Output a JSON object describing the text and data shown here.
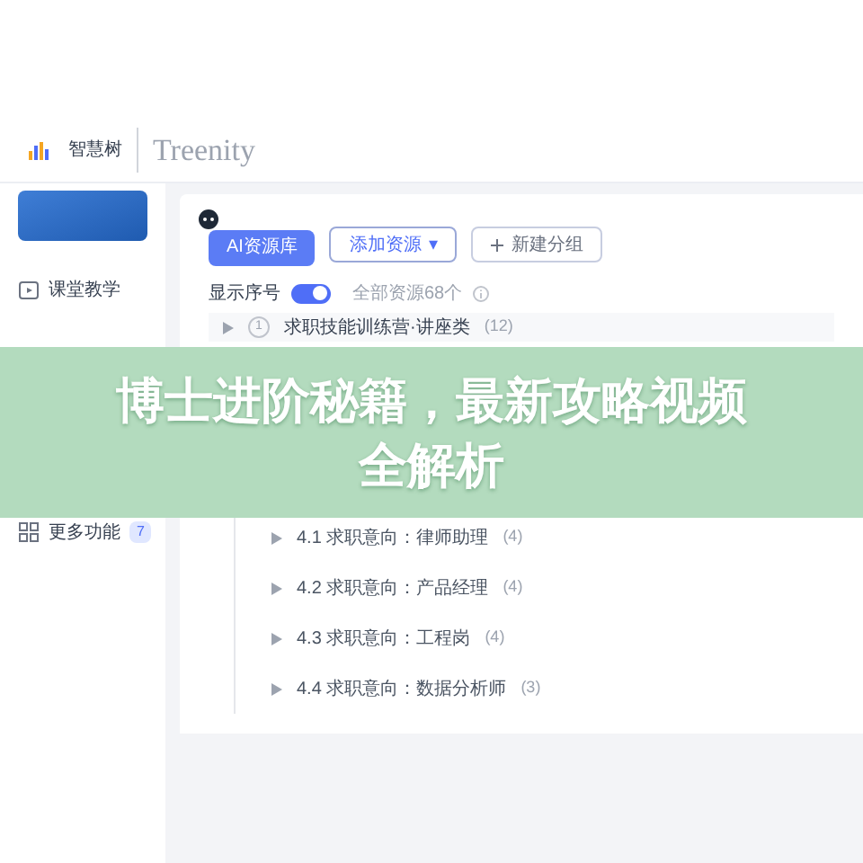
{
  "header": {
    "brand": "智慧树",
    "wordmark": "Treenity"
  },
  "sidebar": {
    "items": [
      {
        "label": "课堂教学",
        "kind": "video"
      },
      {
        "label": "更多功能",
        "kind": "grid",
        "badge": "7"
      }
    ]
  },
  "toolbar": {
    "ai_button": "AI资源库",
    "add_button": "添加资源",
    "add_caret": "▾",
    "group_button": "新建分组"
  },
  "options": {
    "show_index_label": "显示序号",
    "show_index_on": true,
    "total": "全部资源68个"
  },
  "tree": [
    {
      "index": "1",
      "title": "求职技能训练营·讲座类",
      "count": "(12)",
      "expanded": false
    }
  ],
  "subgroups": [
    {
      "title": "4.1 求职意向：律师助理",
      "count": "(4)"
    },
    {
      "title": "4.2 求职意向：产品经理",
      "count": "(4)"
    },
    {
      "title": "4.3 求职意向：工程岗",
      "count": "(4)"
    },
    {
      "title": "4.4 求职意向：数据分析师",
      "count": "(3)"
    }
  ],
  "banner": {
    "lines": [
      "博士进阶秘籍，最新攻略视频",
      "全解析"
    ]
  }
}
